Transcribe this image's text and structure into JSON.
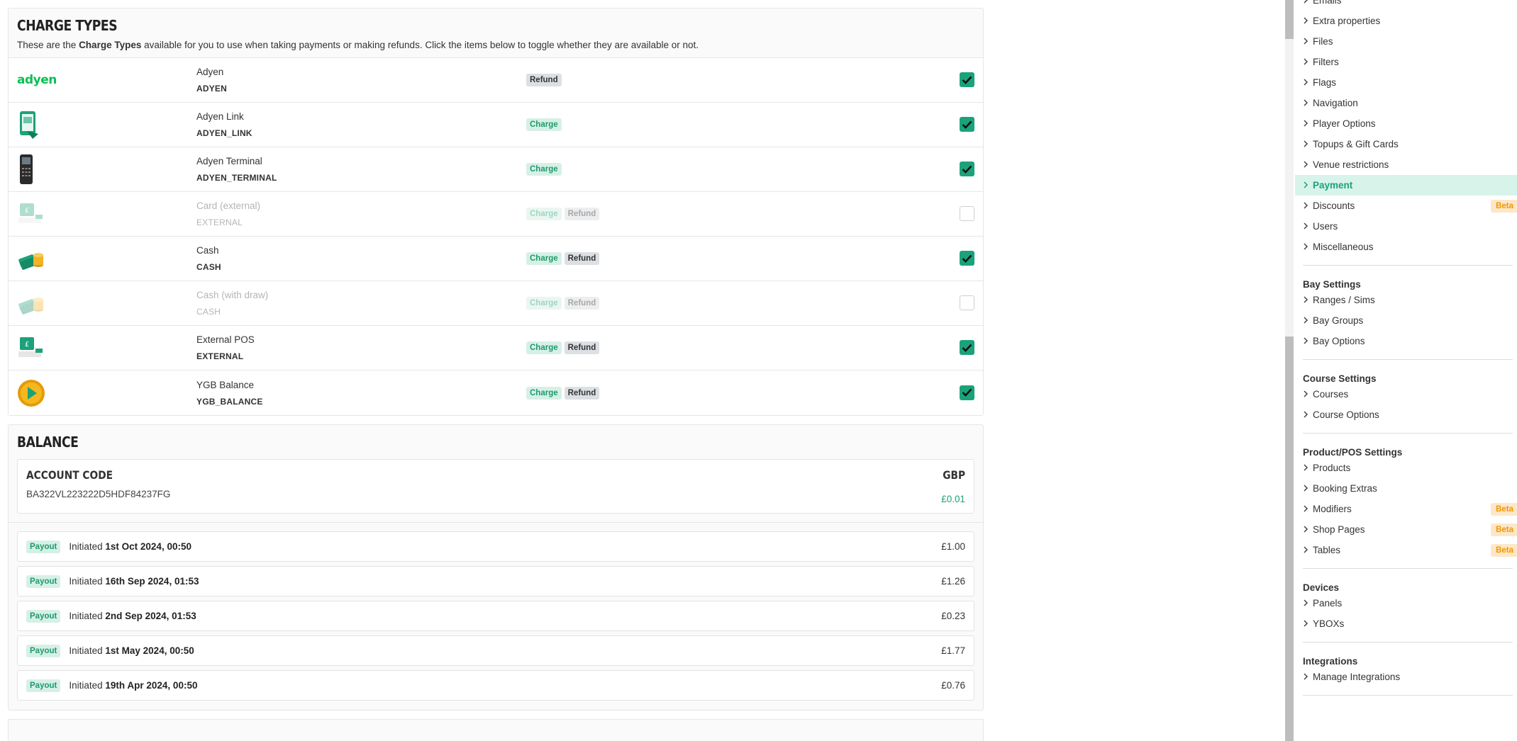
{
  "charge_types": {
    "title": "CHARGE TYPES",
    "desc_before": "These are the ",
    "desc_bold": "Charge Types",
    "desc_after": " available for you to use when taking payments or making refunds. Click the items below to toggle whether they are available or not.",
    "items": [
      {
        "name": "Adyen",
        "code": "ADYEN",
        "icon": "adyen-logo",
        "charge": "",
        "refund": "Refund",
        "enabled": true
      },
      {
        "name": "Adyen Link",
        "code": "ADYEN_LINK",
        "icon": "phone-card-icon",
        "charge": "Charge",
        "refund": "",
        "enabled": true
      },
      {
        "name": "Adyen Terminal",
        "code": "ADYEN_TERMINAL",
        "icon": "card-terminal-icon",
        "charge": "Charge",
        "refund": "",
        "enabled": true
      },
      {
        "name": "Card (external)",
        "code": "EXTERNAL",
        "icon": "pos-till-icon",
        "charge": "Charge",
        "refund": "Refund",
        "enabled": false
      },
      {
        "name": "Cash",
        "code": "CASH",
        "icon": "cash-coins-icon",
        "charge": "Charge",
        "refund": "Refund",
        "enabled": true
      },
      {
        "name": "Cash (with draw)",
        "code": "CASH",
        "icon": "cash-coins-icon",
        "charge": "Charge",
        "refund": "Refund",
        "enabled": false
      },
      {
        "name": "External POS",
        "code": "EXTERNAL",
        "icon": "pos-till-icon",
        "charge": "Charge",
        "refund": "Refund",
        "enabled": true
      },
      {
        "name": "YGB Balance",
        "code": "YGB_BALANCE",
        "icon": "ygb-coin-icon",
        "charge": "Charge",
        "refund": "Refund",
        "enabled": true
      }
    ],
    "adyen_logo_text": "adyen"
  },
  "balance": {
    "title": "BALANCE",
    "account_label": "ACCOUNT CODE",
    "currency": "GBP",
    "account_code": "BA322VL223222D5HDF84237FG",
    "amount": "£0.01",
    "payouts": [
      {
        "tag": "Payout",
        "prefix": "Initiated ",
        "date": "1st Oct 2024, 00:50",
        "amount": "£1.00"
      },
      {
        "tag": "Payout",
        "prefix": "Initiated ",
        "date": "16th Sep 2024, 01:53",
        "amount": "£1.26"
      },
      {
        "tag": "Payout",
        "prefix": "Initiated ",
        "date": "2nd Sep 2024, 01:53",
        "amount": "£0.23"
      },
      {
        "tag": "Payout",
        "prefix": "Initiated ",
        "date": "1st May 2024, 00:50",
        "amount": "£1.77"
      },
      {
        "tag": "Payout",
        "prefix": "Initiated ",
        "date": "19th Apr 2024, 00:50",
        "amount": "£0.76"
      }
    ]
  },
  "sidebar": {
    "general_items": [
      {
        "label": "Emails"
      },
      {
        "label": "Extra properties"
      },
      {
        "label": "Files"
      },
      {
        "label": "Filters"
      },
      {
        "label": "Flags"
      },
      {
        "label": "Navigation"
      },
      {
        "label": "Player Options"
      },
      {
        "label": "Topups & Gift Cards"
      },
      {
        "label": "Venue restrictions"
      },
      {
        "label": "Payment",
        "active": true
      },
      {
        "label": "Discounts",
        "badge": "Beta"
      },
      {
        "label": "Users"
      },
      {
        "label": "Miscellaneous"
      }
    ],
    "sections": [
      {
        "title": "Bay Settings",
        "items": [
          {
            "label": "Ranges / Sims"
          },
          {
            "label": "Bay Groups"
          },
          {
            "label": "Bay Options"
          }
        ]
      },
      {
        "title": "Course Settings",
        "items": [
          {
            "label": "Courses"
          },
          {
            "label": "Course Options"
          }
        ]
      },
      {
        "title": "Product/POS Settings",
        "items": [
          {
            "label": "Products"
          },
          {
            "label": "Booking Extras"
          },
          {
            "label": "Modifiers",
            "badge": "Beta"
          },
          {
            "label": "Shop Pages",
            "badge": "Beta"
          },
          {
            "label": "Tables",
            "badge": "Beta"
          }
        ]
      },
      {
        "title": "Devices",
        "items": [
          {
            "label": "Panels"
          },
          {
            "label": "YBOXs"
          }
        ]
      },
      {
        "title": "Integrations",
        "items": [
          {
            "label": "Manage Integrations"
          }
        ]
      }
    ]
  },
  "colors": {
    "accent": "#1ba27a",
    "beta": "#f29700",
    "active_bg": "#d8f3ea"
  }
}
